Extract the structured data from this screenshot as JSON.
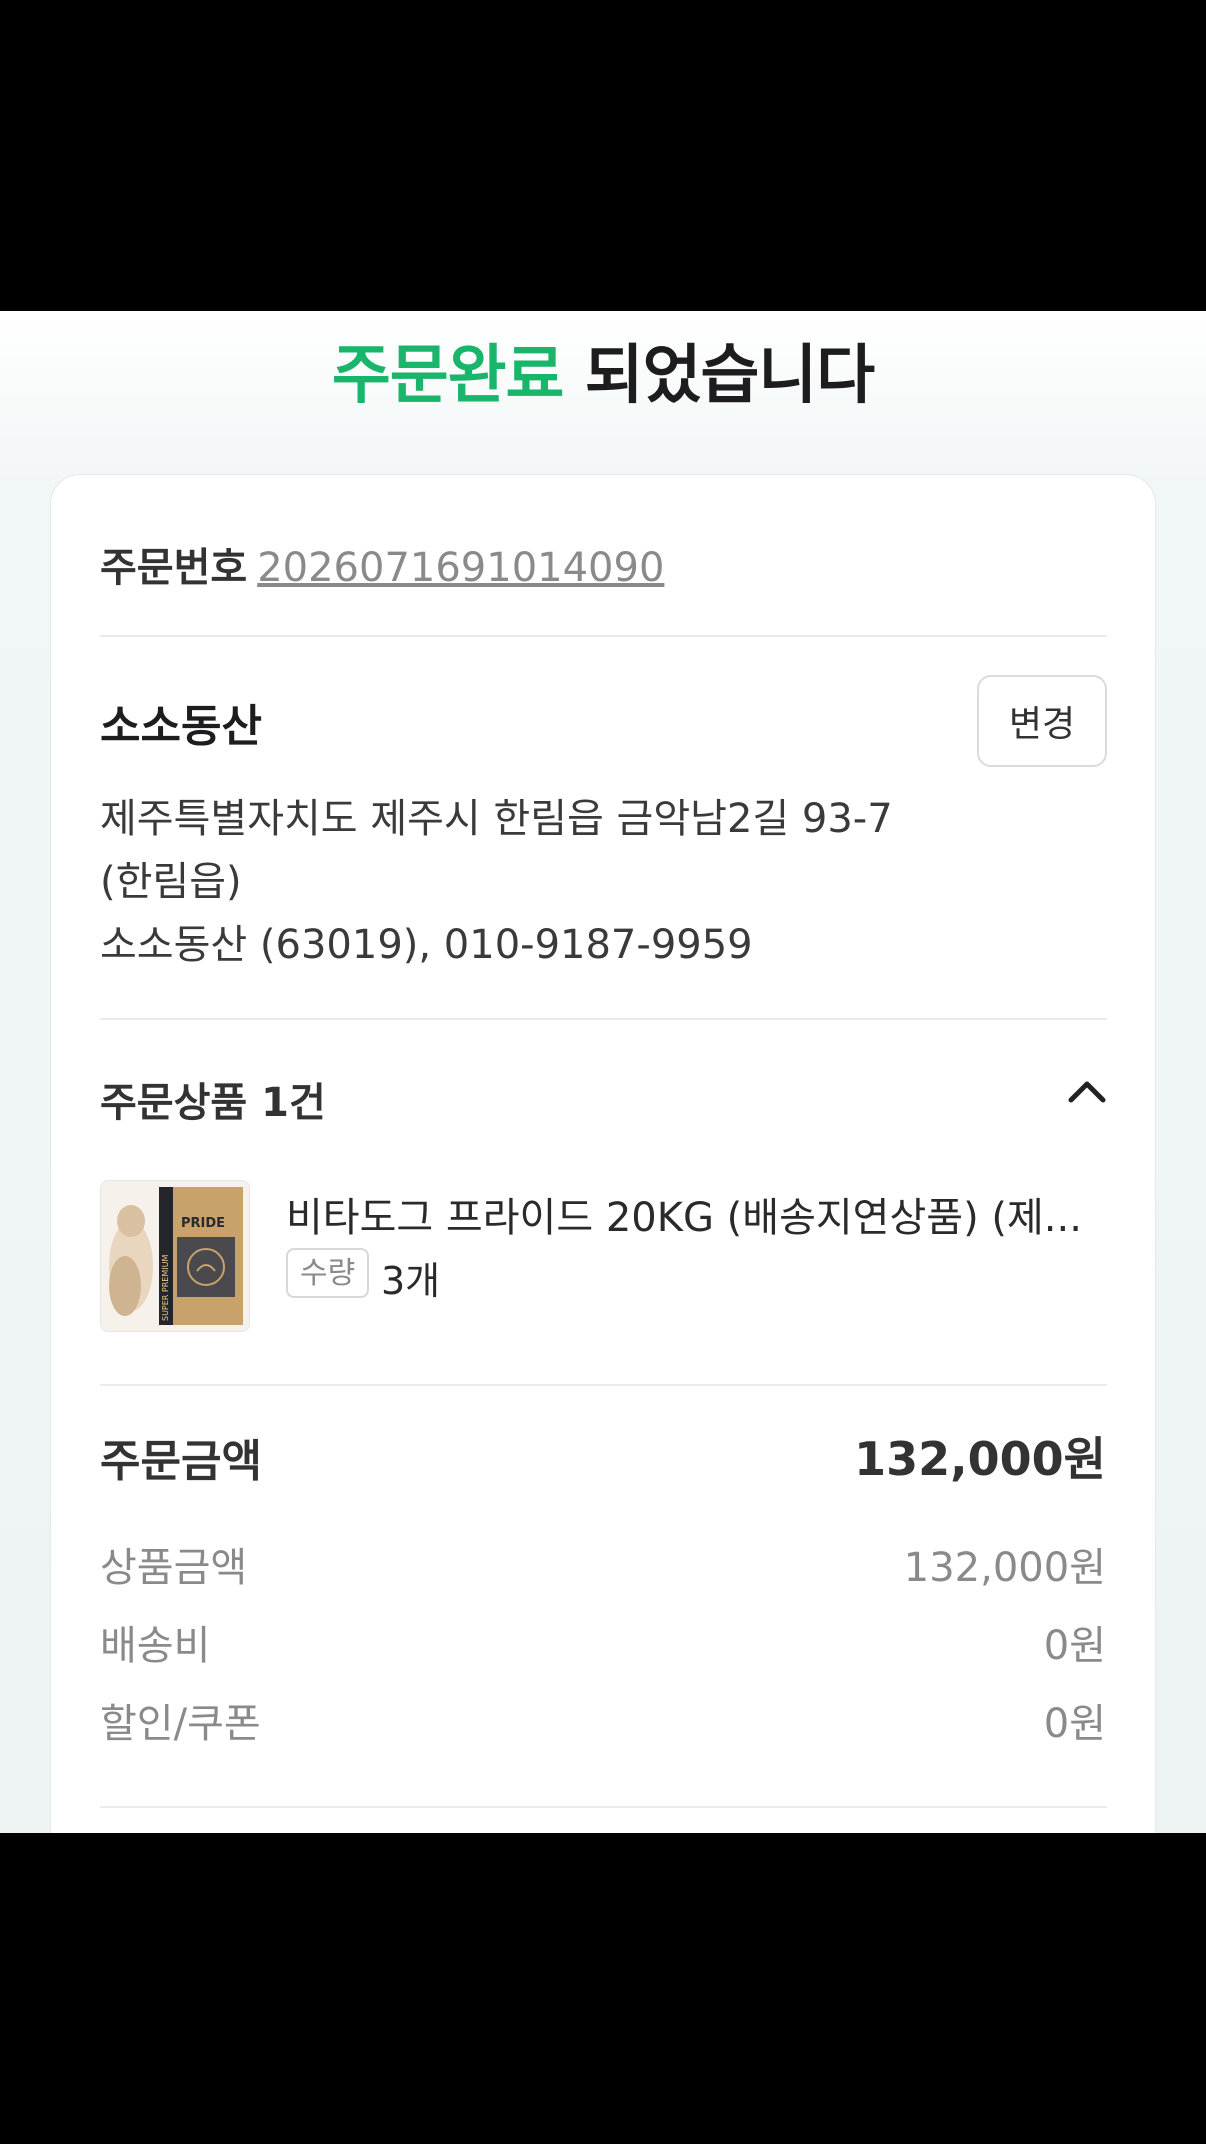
{
  "header": {
    "accent_text": "주문완료",
    "rest_text": " 되었습니다"
  },
  "order": {
    "number_label": "주문번호",
    "number_value": "2026071691014090"
  },
  "shipping": {
    "recipient_name": "소소동산",
    "change_button_label": "변경",
    "address_line1": "제주특별자치도 제주시 한림읍 금악남2길 93-7",
    "address_line2": "(한림읍)",
    "address_line3": "소소동산 (63019), 010-9187-9959"
  },
  "products": {
    "section_title": "주문상품 1건",
    "items": [
      {
        "name": "비타도그 프라이드 20KG (배송지연상품) (제...",
        "qty_label": "수량",
        "qty_value": "3개",
        "image_text": "PRIDE",
        "image_side_text": "SUPER PREMIUM"
      }
    ]
  },
  "payment": {
    "total_label": "주문금액",
    "total_value": "132,000원",
    "rows": [
      {
        "label": "상품금액",
        "value": "132,000원"
      },
      {
        "label": "배송비",
        "value": "0원"
      },
      {
        "label": "할인/쿠폰",
        "value": "0원"
      }
    ]
  },
  "colors": {
    "accent": "#19b56b",
    "text_primary": "#1d1d1f",
    "text_muted": "#8a8a8a"
  },
  "icons": {
    "collapse": "chevron-up-icon"
  }
}
